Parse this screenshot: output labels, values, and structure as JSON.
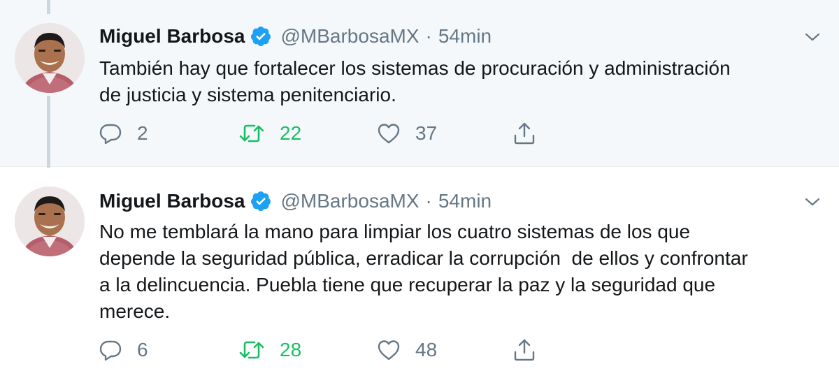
{
  "tweets": [
    {
      "display_name": "Miguel Barbosa",
      "verified": true,
      "handle": "@MBarbosaMX",
      "separator": "·",
      "time": "54min",
      "text": "También hay que fortalecer los sistemas de procuración y administración\nde justicia y sistema penitenciario.",
      "replies": "2",
      "retweets": "22",
      "likes": "37",
      "retweeted": true
    },
    {
      "display_name": "Miguel Barbosa",
      "verified": true,
      "handle": "@MBarbosaMX",
      "separator": "·",
      "time": "54min",
      "text": "No me temblará la mano para limpiar los cuatro sistemas de los que\ndepende la seguridad pública, erradicar la corrupción  de ellos y confrontar\na la delincuencia. Puebla tiene que recuperar la paz y la seguridad que\nmerece.",
      "replies": "6",
      "retweets": "28",
      "likes": "48",
      "retweeted": true
    }
  ],
  "colors": {
    "text_primary": "#14171a",
    "text_secondary": "#657786",
    "verified_blue": "#1da1f2",
    "retweet_green": "#17bf63",
    "highlight_background": "#f5f8fa",
    "thread_line": "#ccd6dd"
  },
  "icons": {
    "verified": "verified-badge-icon",
    "caret": "chevron-down-icon",
    "reply": "reply-bubble-icon",
    "retweet": "retweet-icon",
    "like": "heart-icon",
    "share": "share-upload-icon"
  }
}
